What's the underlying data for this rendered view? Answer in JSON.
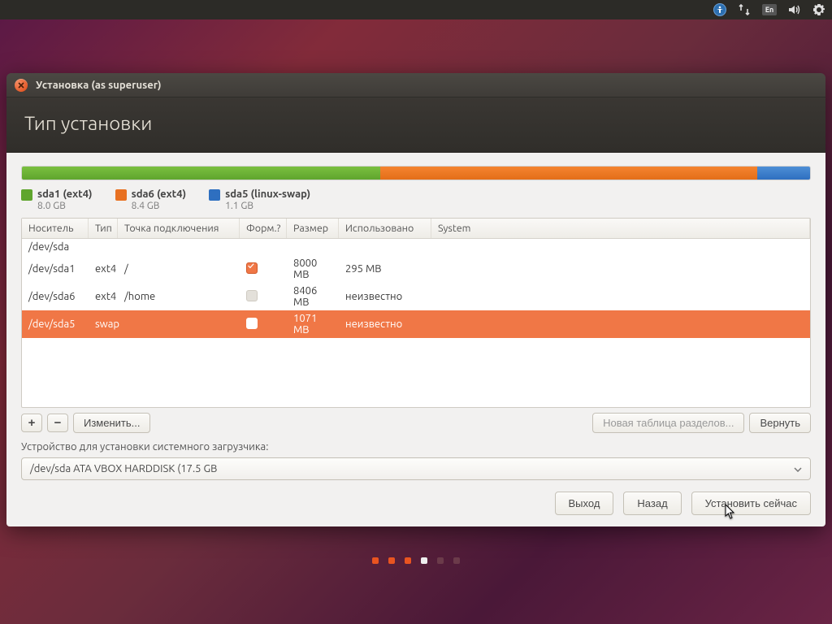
{
  "panel": {
    "lang": "En"
  },
  "window": {
    "title": "Установка (as superuser)",
    "heading": "Тип установки"
  },
  "usage": [
    {
      "color": "green",
      "pctwidth": 45.5
    },
    {
      "color": "orange",
      "pctwidth": 47.8
    },
    {
      "color": "blue",
      "pctwidth": 6.7
    }
  ],
  "legend": [
    {
      "sw": "green",
      "label": "sda1 (ext4)",
      "size": "8.0 GB"
    },
    {
      "sw": "orange",
      "label": "sda6 (ext4)",
      "size": "8.4 GB"
    },
    {
      "sw": "blue",
      "label": "sda5 (linux-swap)",
      "size": "1.1 GB"
    }
  ],
  "columns": {
    "device": "Носитель",
    "type": "Тип",
    "mount": "Точка подключения",
    "format": "Форм.?",
    "size": "Размер",
    "used": "Использовано",
    "system": "System"
  },
  "rows": [
    {
      "device": "/dev/sda",
      "type": "",
      "mount": "",
      "format": "",
      "size": "",
      "used": "",
      "sel": false,
      "kind": "disk"
    },
    {
      "device": "/dev/sda1",
      "type": "ext4",
      "mount": "/",
      "format": "checked",
      "size": "8000 MB",
      "used": "295 MB",
      "sel": false,
      "kind": "part"
    },
    {
      "device": "/dev/sda6",
      "type": "ext4",
      "mount": "/home",
      "format": "disabled",
      "size": "8406 MB",
      "used": "неизвестно",
      "sel": false,
      "kind": "part"
    },
    {
      "device": "/dev/sda5",
      "type": "swap",
      "mount": "",
      "format": "blank",
      "size": "1071 MB",
      "used": "неизвестно",
      "sel": true,
      "kind": "part"
    }
  ],
  "actions": {
    "add": "+",
    "remove": "−",
    "change": "Изменить...",
    "newtable": "Новая таблица разделов...",
    "revert": "Вернуть"
  },
  "boot": {
    "label": "Устройство для установки системного загрузчика:",
    "value": "/dev/sda   ATA VBOX HARDDISK (17.5 GB"
  },
  "footer": {
    "quit": "Выход",
    "back": "Назад",
    "install": "Установить сейчас"
  },
  "dots": [
    "active",
    "active",
    "active",
    "white",
    "off",
    "off"
  ]
}
